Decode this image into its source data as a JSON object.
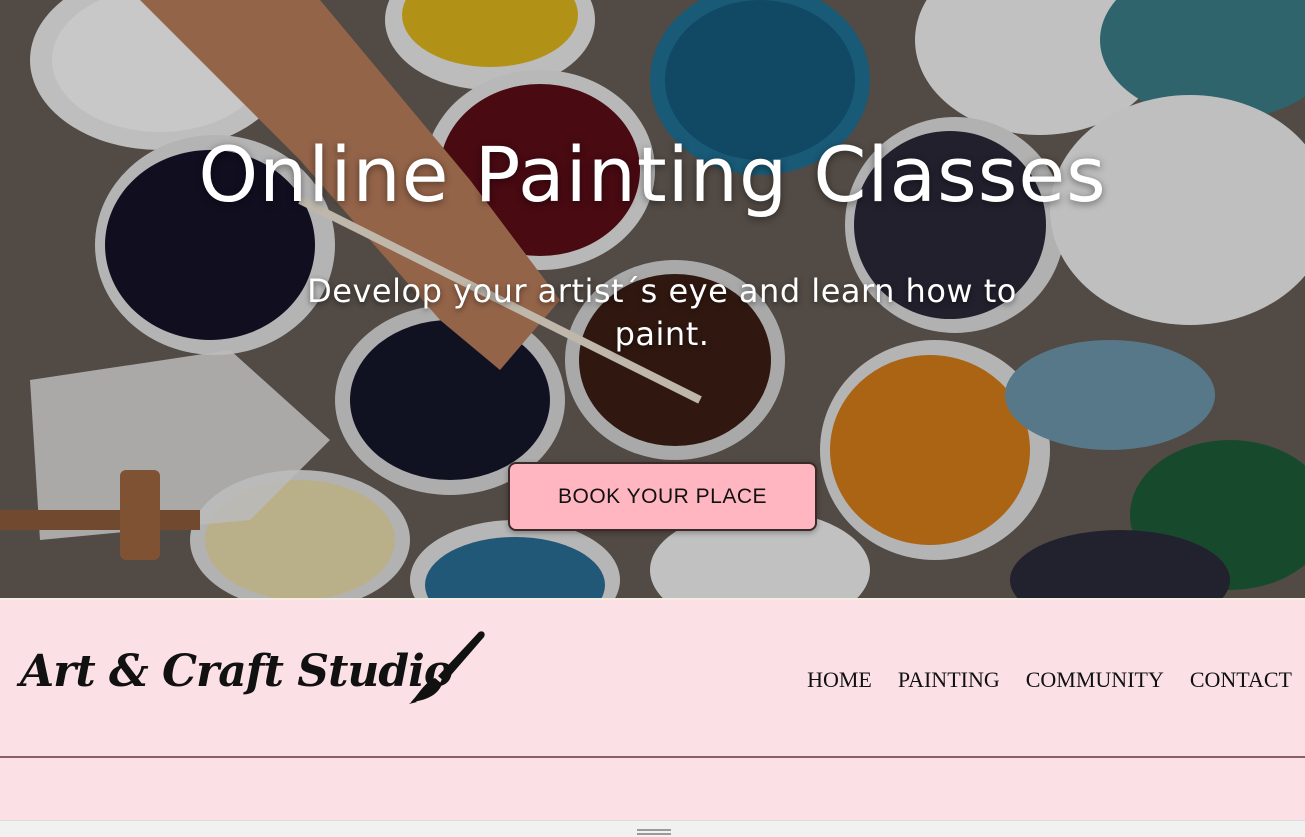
{
  "hero": {
    "title": "Online Painting Classes",
    "subtitle": "Develop your artist´s eye and learn how to paint.",
    "cta_label": "BOOK YOUR PLACE",
    "cta_color": "#ffb6c1",
    "background_image": "photo of paint buckets and a hand holding a brush"
  },
  "header": {
    "logo_text": "Art & Craft Studio",
    "logo_icon": "paintbrush-icon",
    "background_color": "#fbe1e6",
    "nav": [
      {
        "label": "HOME"
      },
      {
        "label": "PAINTING"
      },
      {
        "label": "COMMUNITY"
      },
      {
        "label": "CONTACT"
      }
    ]
  },
  "window": {
    "resize_icon": "resize-handle-icon"
  }
}
